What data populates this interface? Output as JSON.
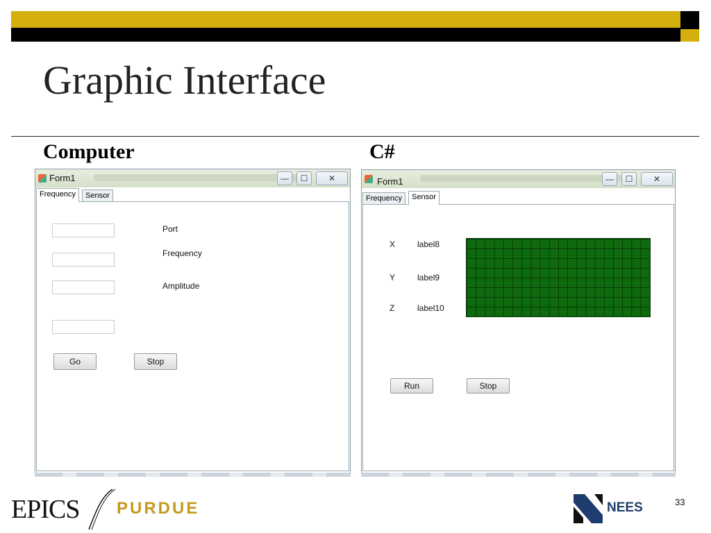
{
  "slide": {
    "title": "Graphic Interface",
    "heading_left": "Computer",
    "heading_right": "C#",
    "page_number": "33"
  },
  "colors": {
    "gold": "#D4AF0E",
    "black": "#000000",
    "grid_green": "#0F6A0F",
    "purdue_gold": "#C49A1E",
    "nees_blue": "#1E3C6E"
  },
  "window_left": {
    "title": "Form1",
    "controls": {
      "minimize": "—",
      "maximize": "☐",
      "close": "✕"
    },
    "tabs": [
      {
        "label": "Frequency",
        "active": true
      },
      {
        "label": "Sensor",
        "active": false
      }
    ],
    "labels": {
      "port": "Port",
      "frequency": "Frequency",
      "amplitude": "Amplitude"
    },
    "inputs": {
      "port_value": "",
      "frequency_value": "",
      "amplitude_value": "",
      "extra_value": ""
    },
    "buttons": {
      "go": "Go",
      "stop": "Stop"
    }
  },
  "window_right": {
    "title": "Form1",
    "controls": {
      "minimize": "—",
      "maximize": "☐",
      "close": "✕"
    },
    "tabs": [
      {
        "label": "Frequency",
        "active": false
      },
      {
        "label": "Sensor",
        "active": true
      }
    ],
    "axes": [
      {
        "axis": "X",
        "value": "label8"
      },
      {
        "axis": "Y",
        "value": "label9"
      },
      {
        "axis": "Z",
        "value": "label10"
      }
    ],
    "buttons": {
      "run": "Run",
      "stop": "Stop"
    }
  },
  "footer": {
    "logo_left": "EPICS",
    "logo_left_2": "PURDUE",
    "logo_right": "NEES"
  },
  "icons": [
    "window-app-icon",
    "minimize-icon",
    "maximize-icon",
    "close-icon",
    "nees-logo-icon",
    "epics-slash-icon"
  ]
}
